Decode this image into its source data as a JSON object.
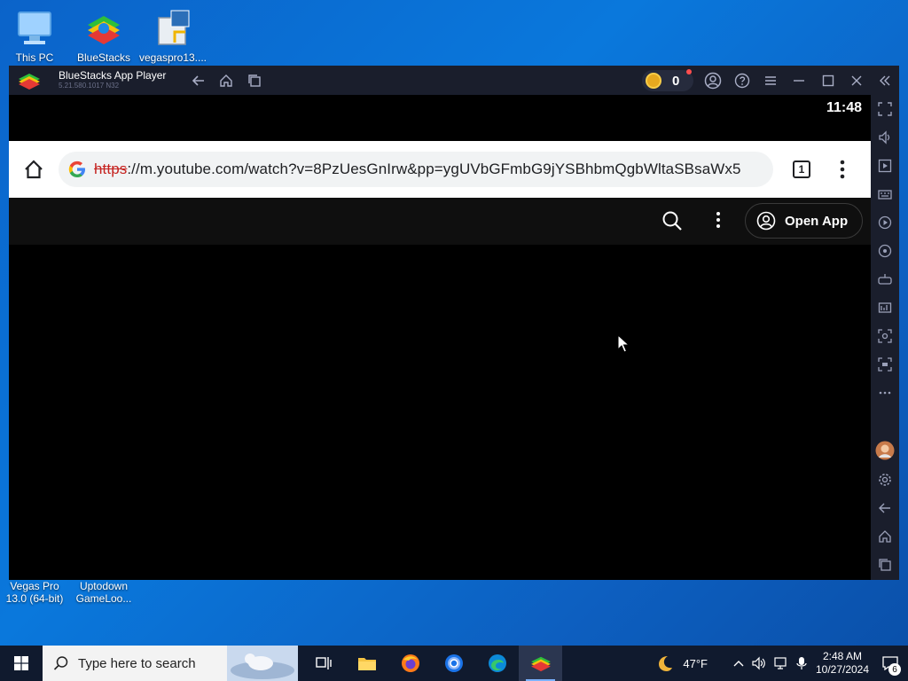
{
  "desktop": {
    "icons_top": [
      {
        "label": "This PC"
      },
      {
        "label": "BlueStacks"
      },
      {
        "label": "vegaspro13...."
      }
    ],
    "icons_bottom": [
      {
        "label": "Vegas Pro 13.0 (64-bit)"
      },
      {
        "label": "Uptodown GameLoo..."
      }
    ]
  },
  "bluestacks": {
    "title": "BlueStacks App Player",
    "version": "5.21.580.1017 N32",
    "coins": "0",
    "colors": {
      "titlebar": "#1a1e2c",
      "coin": "#e7a91f"
    }
  },
  "android": {
    "status_time": "11:48",
    "chrome": {
      "url_scheme": "https",
      "url_rest": "://m.youtube.com/watch?v=8PzUesGnIrw&pp=ygUVbGFmbG9jYSBhbmQgbWltaSBsaWx5",
      "tab_count": "1"
    },
    "youtube": {
      "open_app_label": "Open App"
    }
  },
  "taskbar": {
    "search_placeholder": "Type here to search",
    "weather_temp": "47°F",
    "time": "2:48 AM",
    "date": "10/27/2024",
    "notification_count": "6"
  }
}
